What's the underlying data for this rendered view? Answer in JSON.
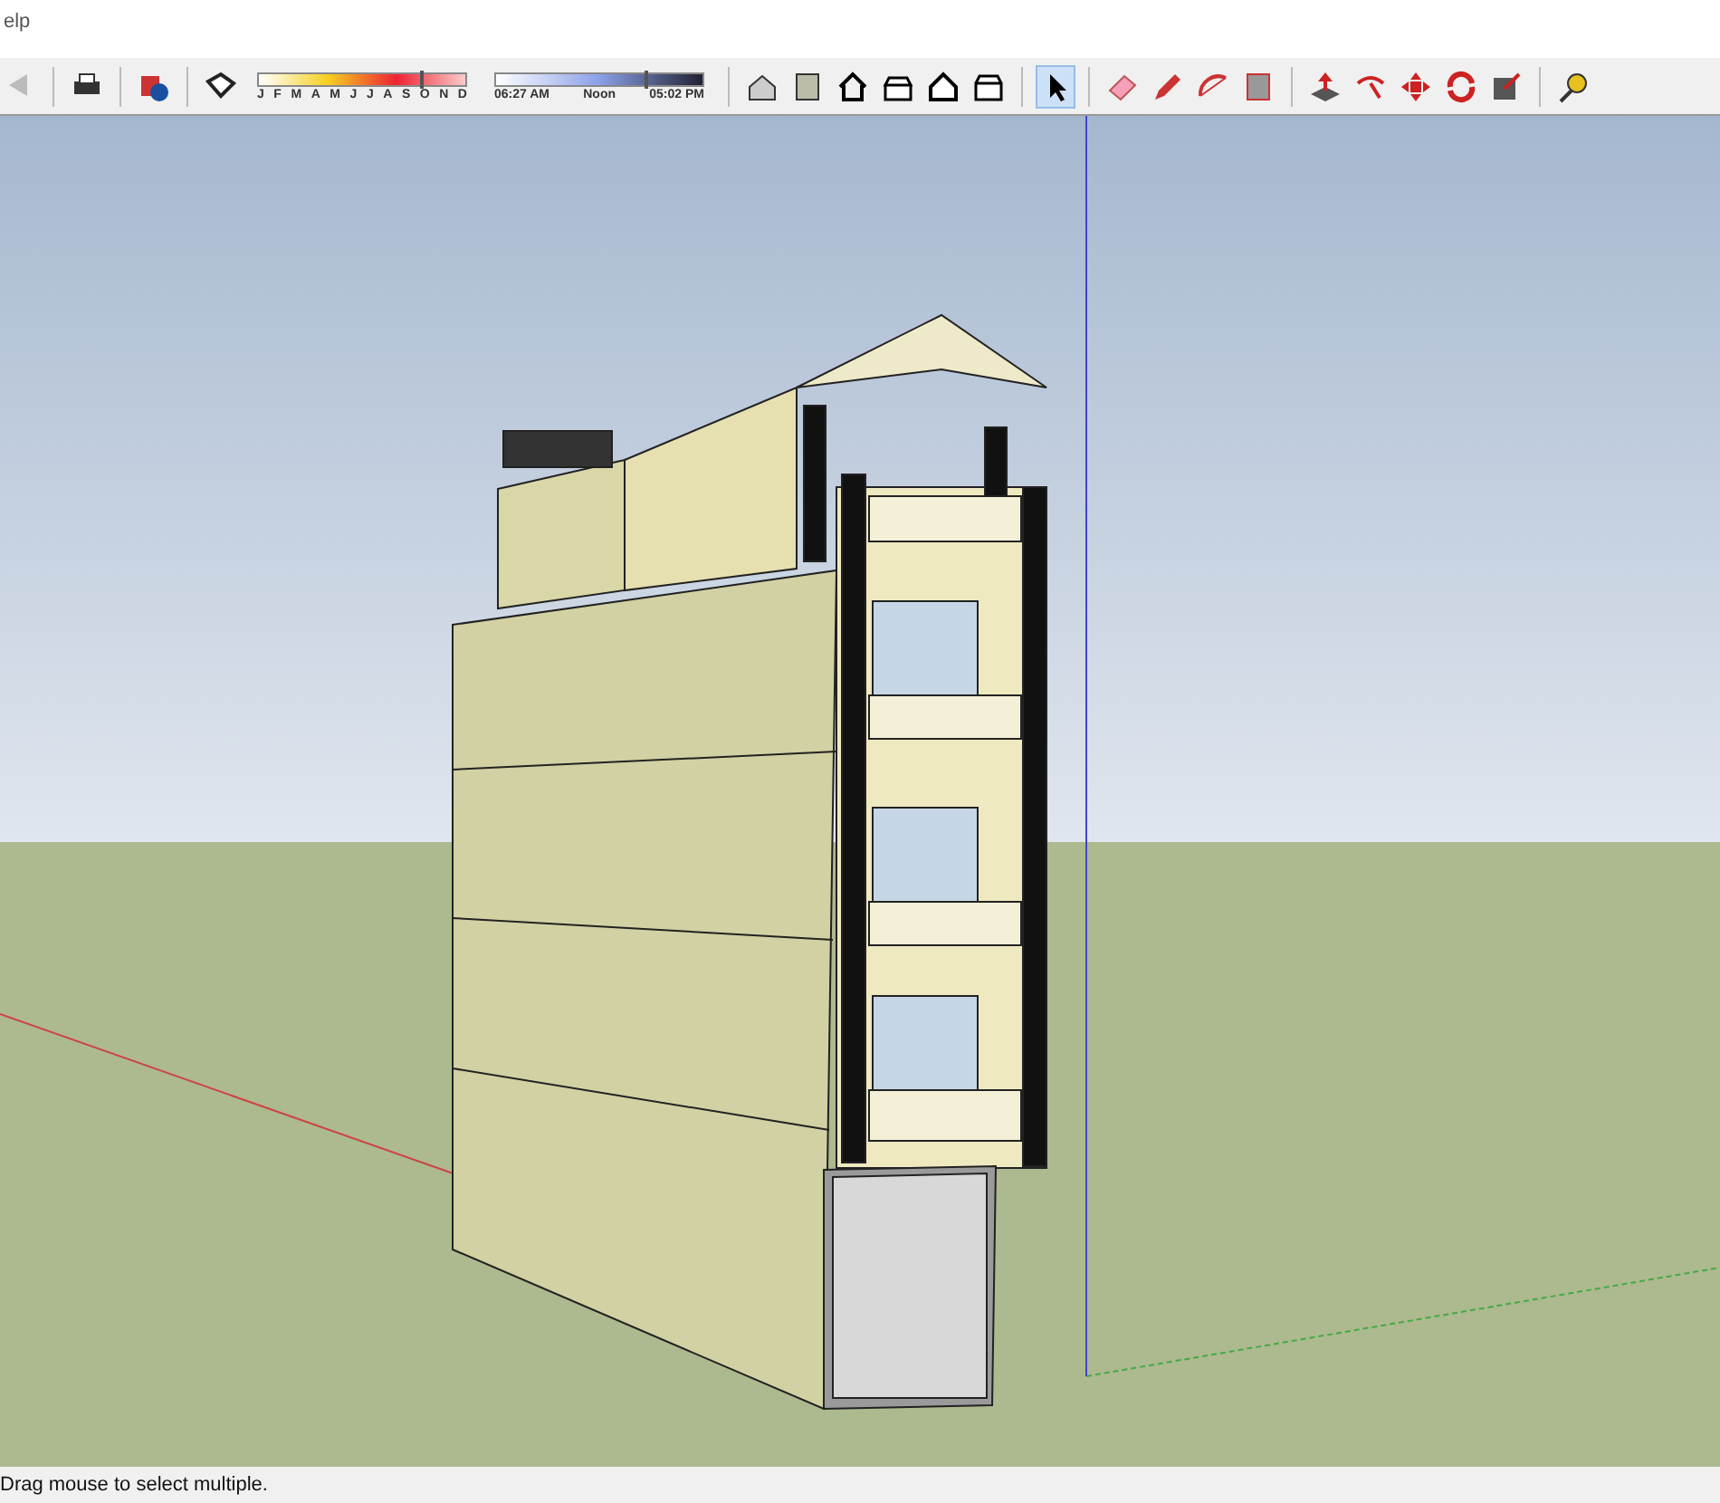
{
  "menu_bar": {
    "items": [
      "elp"
    ]
  },
  "toolbar": {
    "select_tool": {
      "selected": true
    },
    "shadow_date": {
      "months": [
        "J",
        "F",
        "M",
        "A",
        "M",
        "J",
        "J",
        "A",
        "S",
        "O",
        "N",
        "D"
      ],
      "level": 0.78
    },
    "shadow_time": {
      "times": [
        "06:27 AM",
        "Noon",
        "05:02 PM"
      ],
      "level": 0.72
    }
  },
  "status_bar": {
    "text": "Drag mouse to select multiple."
  }
}
